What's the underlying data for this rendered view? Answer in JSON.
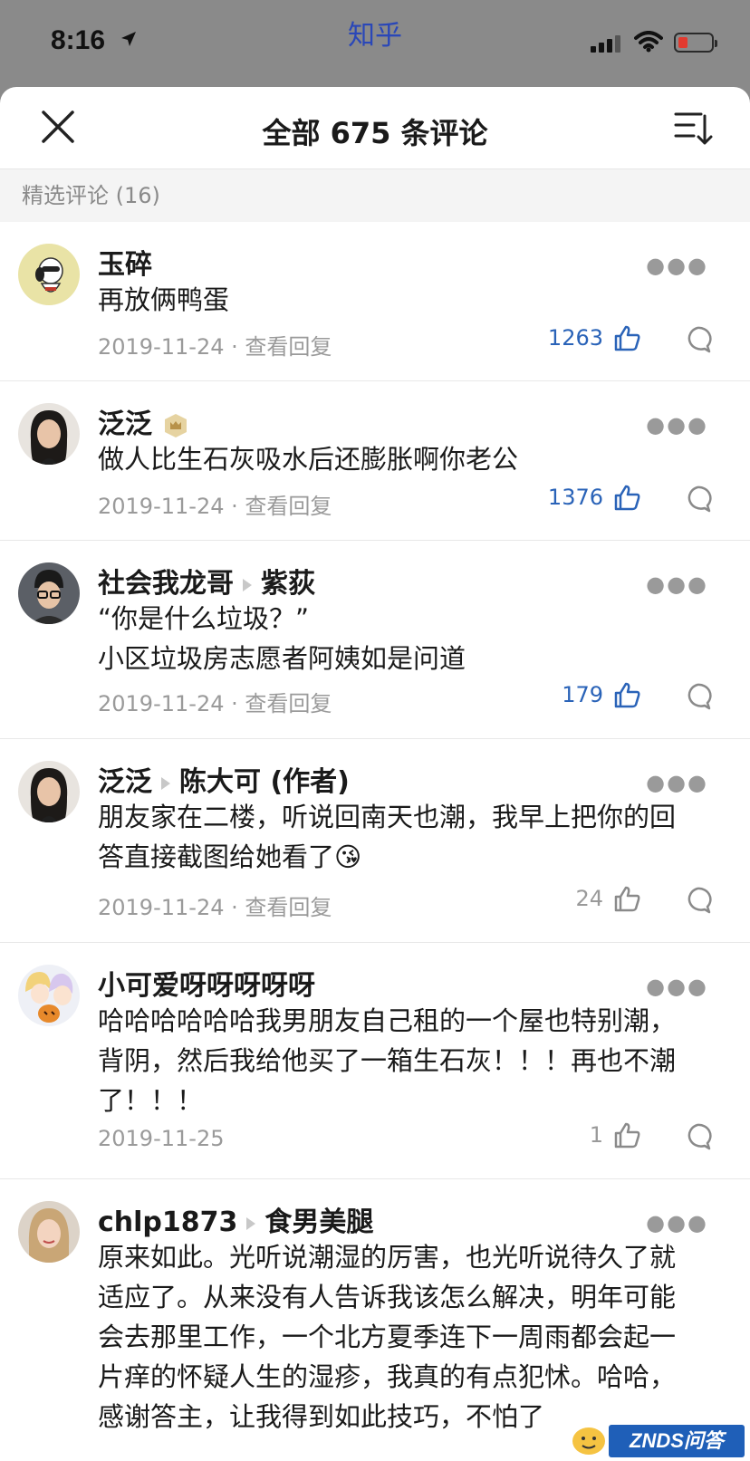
{
  "status_bar": {
    "time": "8:16",
    "app_name": "知乎"
  },
  "sheet": {
    "title": "全部 675 条评论"
  },
  "section": {
    "label": "精选评论 (16)"
  },
  "comments": [
    {
      "author": "玉碎",
      "reply_to": "",
      "lines": [
        "再放俩鸭蛋"
      ],
      "date": "2019-11-24",
      "view_replies": "· 查看回复",
      "likes": "1263"
    },
    {
      "author": "泛泛",
      "reply_to": "",
      "lines": [
        "做人比生石灰吸水后还膨胀啊你老公"
      ],
      "date": "2019-11-24",
      "view_replies": "· 查看回复",
      "likes": "1376"
    },
    {
      "author": "社会我龙哥",
      "reply_to": "紫荻",
      "lines": [
        "“你是什么垃圾？”",
        "小区垃圾房志愿者阿姨如是问道"
      ],
      "date": "2019-11-24",
      "view_replies": "· 查看回复",
      "likes": "179"
    },
    {
      "author": "泛泛",
      "reply_to": "陈大可 (作者)",
      "lines": [
        "朋友家在二楼，听说回南天也潮，我早上把你的回",
        "答直接截图给她看了😘"
      ],
      "date": "2019-11-24",
      "view_replies": "· 查看回复",
      "likes": "24"
    },
    {
      "author": "小可爱呀呀呀呀呀",
      "reply_to": "",
      "lines": [
        "哈哈哈哈哈哈我男朋友自己租的一个屋也特别潮，",
        "背阴，然后我给他买了一箱生石灰！！！再也不潮",
        "了！！！"
      ],
      "date": "2019-11-25",
      "view_replies": "",
      "likes": "1"
    },
    {
      "author": "chlp1873",
      "reply_to": "食男美腿",
      "lines": [
        "原来如此。光听说潮湿的厉害，也光听说待久了就",
        "适应了。从来没有人告诉我该怎么解决，明年可能",
        "会去那里工作，一个北方夏季连下一周雨都会起一",
        "片痒的怀疑人生的湿疹，我真的有点犯怵。哈哈，",
        "感谢答主，让我得到如此技巧，不怕了"
      ],
      "date": "",
      "view_replies": "",
      "likes": ""
    }
  ],
  "watermark": {
    "text": "ZNDS问答"
  },
  "colors": {
    "accent_blue": "#2a63b8",
    "status_bg": "#8a8a8a",
    "battery_low": "#e23a2f"
  }
}
